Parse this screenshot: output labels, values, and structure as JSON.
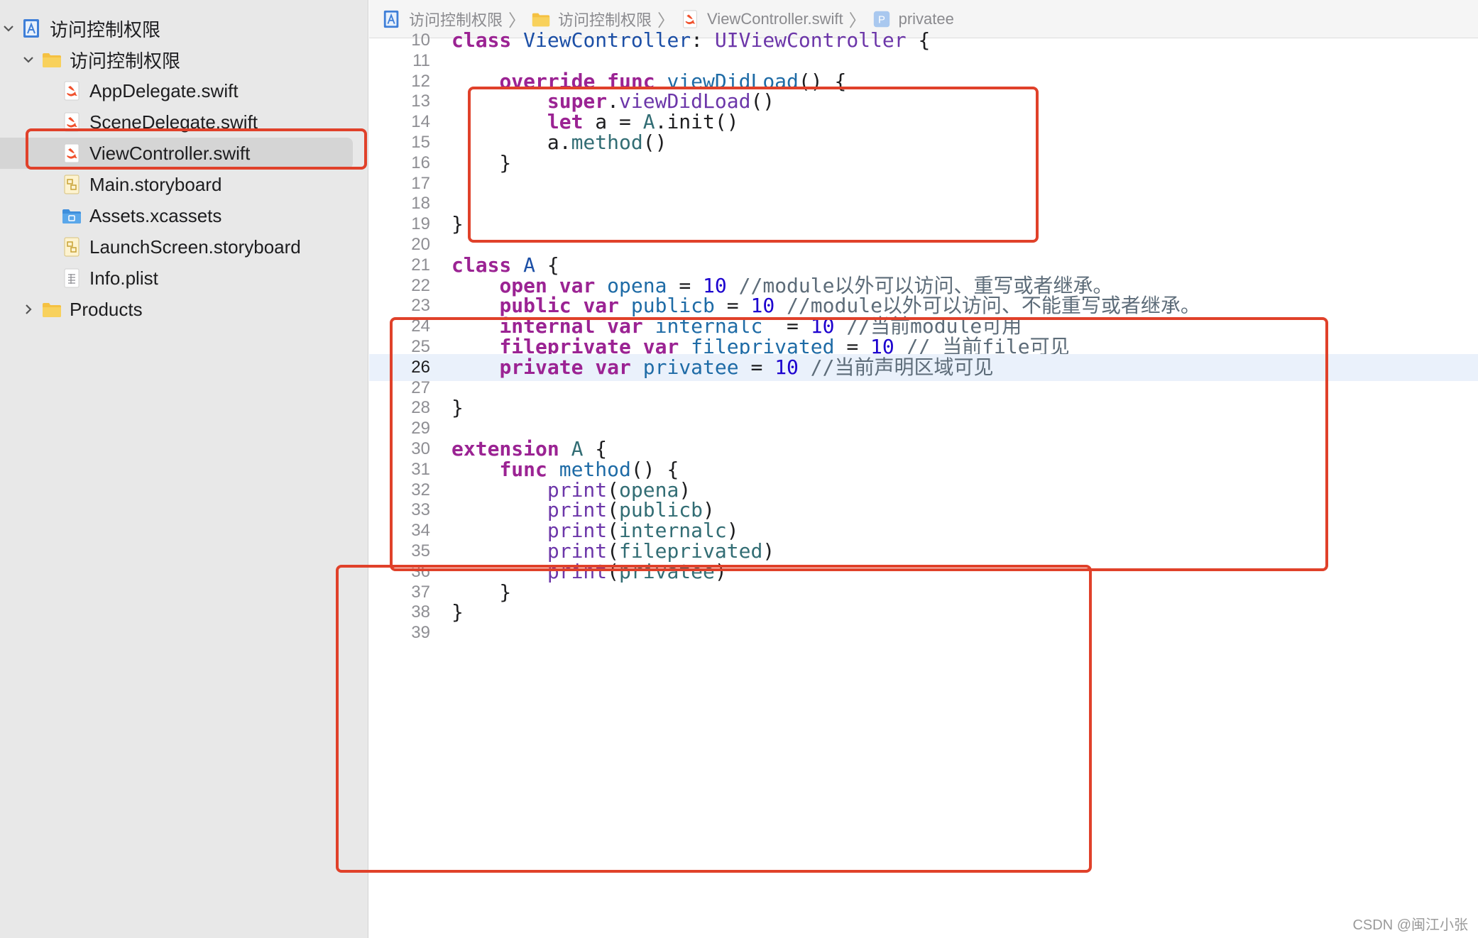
{
  "navigator": {
    "items": [
      {
        "label": "访问控制权限",
        "icon": "xcode-project-icon",
        "chevron": "down"
      },
      {
        "label": "访问控制权限",
        "icon": "folder-icon",
        "chevron": "down"
      },
      {
        "label": "AppDelegate.swift",
        "icon": "swift-file-icon"
      },
      {
        "label": "SceneDelegate.swift",
        "icon": "swift-file-icon"
      },
      {
        "label": "ViewController.swift",
        "icon": "swift-file-icon",
        "selected": true
      },
      {
        "label": "Main.storyboard",
        "icon": "storyboard-icon"
      },
      {
        "label": "Assets.xcassets",
        "icon": "assets-folder-icon"
      },
      {
        "label": "LaunchScreen.storyboard",
        "icon": "storyboard-icon"
      },
      {
        "label": "Info.plist",
        "icon": "plist-icon"
      },
      {
        "label": "Products",
        "icon": "folder-icon",
        "chevron": "right"
      }
    ]
  },
  "breadcrumb": {
    "items": [
      {
        "label": "访问控制权限",
        "icon": "xcode-project-icon"
      },
      {
        "label": "访问控制权限",
        "icon": "folder-icon"
      },
      {
        "label": "ViewController.swift",
        "icon": "swift-file-icon"
      },
      {
        "label": "privatee",
        "icon": "property-icon"
      }
    ],
    "separator": "〉"
  },
  "editor": {
    "current_line": 26,
    "lines": [
      {
        "n": "10",
        "t": [
          [
            "kw",
            "class"
          ],
          [
            "p",
            " "
          ],
          [
            "type",
            "ViewController"
          ],
          [
            "p",
            ": "
          ],
          [
            "call",
            "UIViewController"
          ],
          [
            "p",
            " {"
          ]
        ]
      },
      {
        "n": "11",
        "t": []
      },
      {
        "n": "12",
        "t": [
          [
            "p",
            "    "
          ],
          [
            "kw",
            "override"
          ],
          [
            "p",
            " "
          ],
          [
            "kw",
            "func"
          ],
          [
            "p",
            " "
          ],
          [
            "decl",
            "viewDidLoad"
          ],
          [
            "p",
            "() {"
          ]
        ]
      },
      {
        "n": "13",
        "t": [
          [
            "p",
            "        "
          ],
          [
            "kw",
            "super"
          ],
          [
            "p",
            "."
          ],
          [
            "call",
            "viewDidLoad"
          ],
          [
            "p",
            "()"
          ]
        ]
      },
      {
        "n": "14",
        "t": [
          [
            "p",
            "        "
          ],
          [
            "kw",
            "let"
          ],
          [
            "p",
            " a = "
          ],
          [
            "var",
            "A"
          ],
          [
            "p",
            ".init()"
          ]
        ]
      },
      {
        "n": "15",
        "t": [
          [
            "p",
            "        a."
          ],
          [
            "var",
            "method"
          ],
          [
            "p",
            "()"
          ]
        ]
      },
      {
        "n": "16",
        "t": [
          [
            "p",
            "    }"
          ]
        ]
      },
      {
        "n": "17",
        "t": []
      },
      {
        "n": "18",
        "t": []
      },
      {
        "n": "19",
        "t": [
          [
            "p",
            "}"
          ]
        ]
      },
      {
        "n": "20",
        "t": []
      },
      {
        "n": "21",
        "t": [
          [
            "kw",
            "class"
          ],
          [
            "p",
            " "
          ],
          [
            "type",
            "A"
          ],
          [
            "p",
            " {"
          ]
        ]
      },
      {
        "n": "22",
        "t": [
          [
            "p",
            "    "
          ],
          [
            "kw",
            "open"
          ],
          [
            "p",
            " "
          ],
          [
            "kw",
            "var"
          ],
          [
            "p",
            " "
          ],
          [
            "decl",
            "opena"
          ],
          [
            "p",
            " = "
          ],
          [
            "num",
            "10"
          ],
          [
            "p",
            " "
          ],
          [
            "c",
            "//module以外可以访问、重写或者继承。"
          ]
        ]
      },
      {
        "n": "23",
        "t": [
          [
            "p",
            "    "
          ],
          [
            "kw",
            "public"
          ],
          [
            "p",
            " "
          ],
          [
            "kw",
            "var"
          ],
          [
            "p",
            " "
          ],
          [
            "decl",
            "publicb"
          ],
          [
            "p",
            " = "
          ],
          [
            "num",
            "10"
          ],
          [
            "p",
            " "
          ],
          [
            "c",
            "//module以外可以访问、不能重写或者继承。"
          ]
        ]
      },
      {
        "n": "24",
        "t": [
          [
            "p",
            "    "
          ],
          [
            "kw",
            "internal"
          ],
          [
            "p",
            " "
          ],
          [
            "kw",
            "var"
          ],
          [
            "p",
            " "
          ],
          [
            "decl",
            "internalc"
          ],
          [
            "p",
            "  = "
          ],
          [
            "num",
            "10"
          ],
          [
            "p",
            " "
          ],
          [
            "c",
            "//当前module可用"
          ]
        ]
      },
      {
        "n": "25",
        "t": [
          [
            "p",
            "    "
          ],
          [
            "kw",
            "fileprivate"
          ],
          [
            "p",
            " "
          ],
          [
            "kw",
            "var"
          ],
          [
            "p",
            " "
          ],
          [
            "decl",
            "fileprivated"
          ],
          [
            "p",
            " = "
          ],
          [
            "num",
            "10"
          ],
          [
            "p",
            " "
          ],
          [
            "c",
            "// 当前file可见"
          ]
        ]
      },
      {
        "n": "26",
        "t": [
          [
            "p",
            "    "
          ],
          [
            "kw",
            "private"
          ],
          [
            "p",
            " "
          ],
          [
            "kw",
            "var"
          ],
          [
            "p",
            " "
          ],
          [
            "decl",
            "privatee"
          ],
          [
            "p",
            " = "
          ],
          [
            "num",
            "10"
          ],
          [
            "p",
            " "
          ],
          [
            "c",
            "//当前声明区域可见"
          ]
        ]
      },
      {
        "n": "27",
        "t": []
      },
      {
        "n": "28",
        "t": [
          [
            "p",
            "}"
          ]
        ]
      },
      {
        "n": "29",
        "t": []
      },
      {
        "n": "30",
        "t": [
          [
            "kw",
            "extension"
          ],
          [
            "p",
            " "
          ],
          [
            "var",
            "A"
          ],
          [
            "p",
            " {"
          ]
        ]
      },
      {
        "n": "31",
        "t": [
          [
            "p",
            "    "
          ],
          [
            "kw",
            "func"
          ],
          [
            "p",
            " "
          ],
          [
            "decl",
            "method"
          ],
          [
            "p",
            "() {"
          ]
        ]
      },
      {
        "n": "32",
        "t": [
          [
            "p",
            "        "
          ],
          [
            "call",
            "print"
          ],
          [
            "p",
            "("
          ],
          [
            "var",
            "opena"
          ],
          [
            "p",
            ")"
          ]
        ]
      },
      {
        "n": "33",
        "t": [
          [
            "p",
            "        "
          ],
          [
            "call",
            "print"
          ],
          [
            "p",
            "("
          ],
          [
            "var",
            "publicb"
          ],
          [
            "p",
            ")"
          ]
        ]
      },
      {
        "n": "34",
        "t": [
          [
            "p",
            "        "
          ],
          [
            "call",
            "print"
          ],
          [
            "p",
            "("
          ],
          [
            "var",
            "internalc"
          ],
          [
            "p",
            ")"
          ]
        ]
      },
      {
        "n": "35",
        "t": [
          [
            "p",
            "        "
          ],
          [
            "call",
            "print"
          ],
          [
            "p",
            "("
          ],
          [
            "var",
            "fileprivated"
          ],
          [
            "p",
            ")"
          ]
        ]
      },
      {
        "n": "36",
        "t": [
          [
            "p",
            "        "
          ],
          [
            "call",
            "print"
          ],
          [
            "p",
            "("
          ],
          [
            "var",
            "privatee"
          ],
          [
            "p",
            ")"
          ]
        ]
      },
      {
        "n": "37",
        "t": [
          [
            "p",
            "    }"
          ]
        ]
      },
      {
        "n": "38",
        "t": [
          [
            "p",
            "}"
          ]
        ]
      },
      {
        "n": "39",
        "t": []
      }
    ]
  },
  "annotations": {
    "color": "#e0412a"
  },
  "watermark": "CSDN @闽江小张"
}
